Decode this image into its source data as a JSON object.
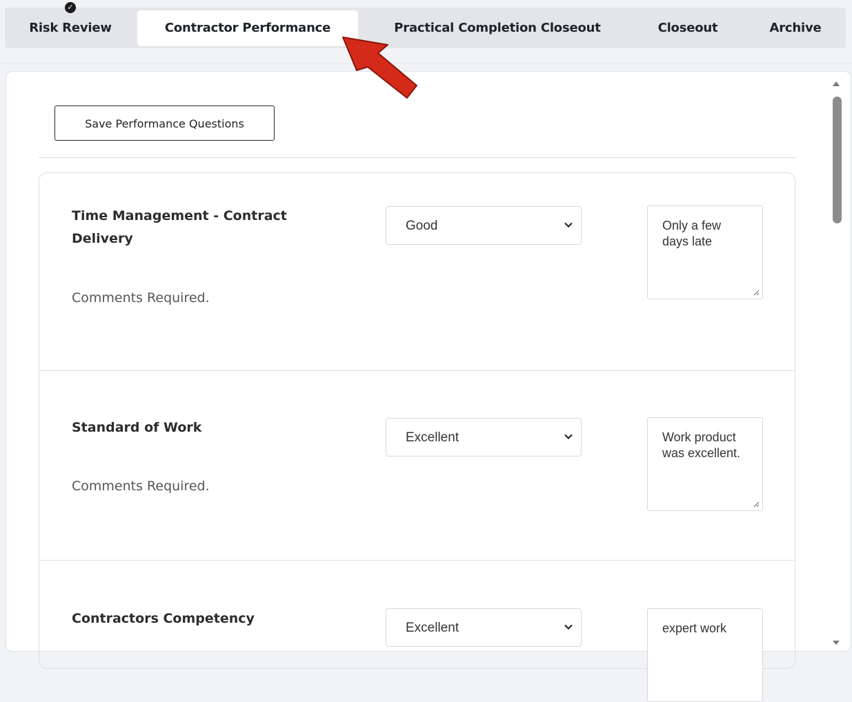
{
  "tabs": [
    {
      "label": "Risk Review",
      "completed": true
    },
    {
      "label": "Contractor Performance",
      "active": true
    },
    {
      "label": "Practical Completion Closeout"
    },
    {
      "label": "Closeout"
    },
    {
      "label": "Archive"
    }
  ],
  "toolbar": {
    "save_label": "Save Performance Questions"
  },
  "questions": [
    {
      "title": "Time Management - Contract Delivery",
      "note": "Comments Required.",
      "rating": "Good",
      "comment": "Only a few days late"
    },
    {
      "title": "Standard of Work",
      "note": "Comments Required.",
      "rating": "Excellent",
      "comment": "Work product was excellent."
    },
    {
      "title": "Contractors Competency",
      "rating": "Excellent",
      "comment": "expert work"
    }
  ],
  "colors": {
    "arrow": "#d42a1a",
    "badge": "#1a1a1a",
    "tab_active_bg": "#ffffff",
    "tab_bar_bg": "#e3e5e9"
  },
  "icons": [
    "check-circle-icon",
    "chevron-down-icon",
    "resize-handle-icon",
    "annotation-arrow-icon"
  ]
}
